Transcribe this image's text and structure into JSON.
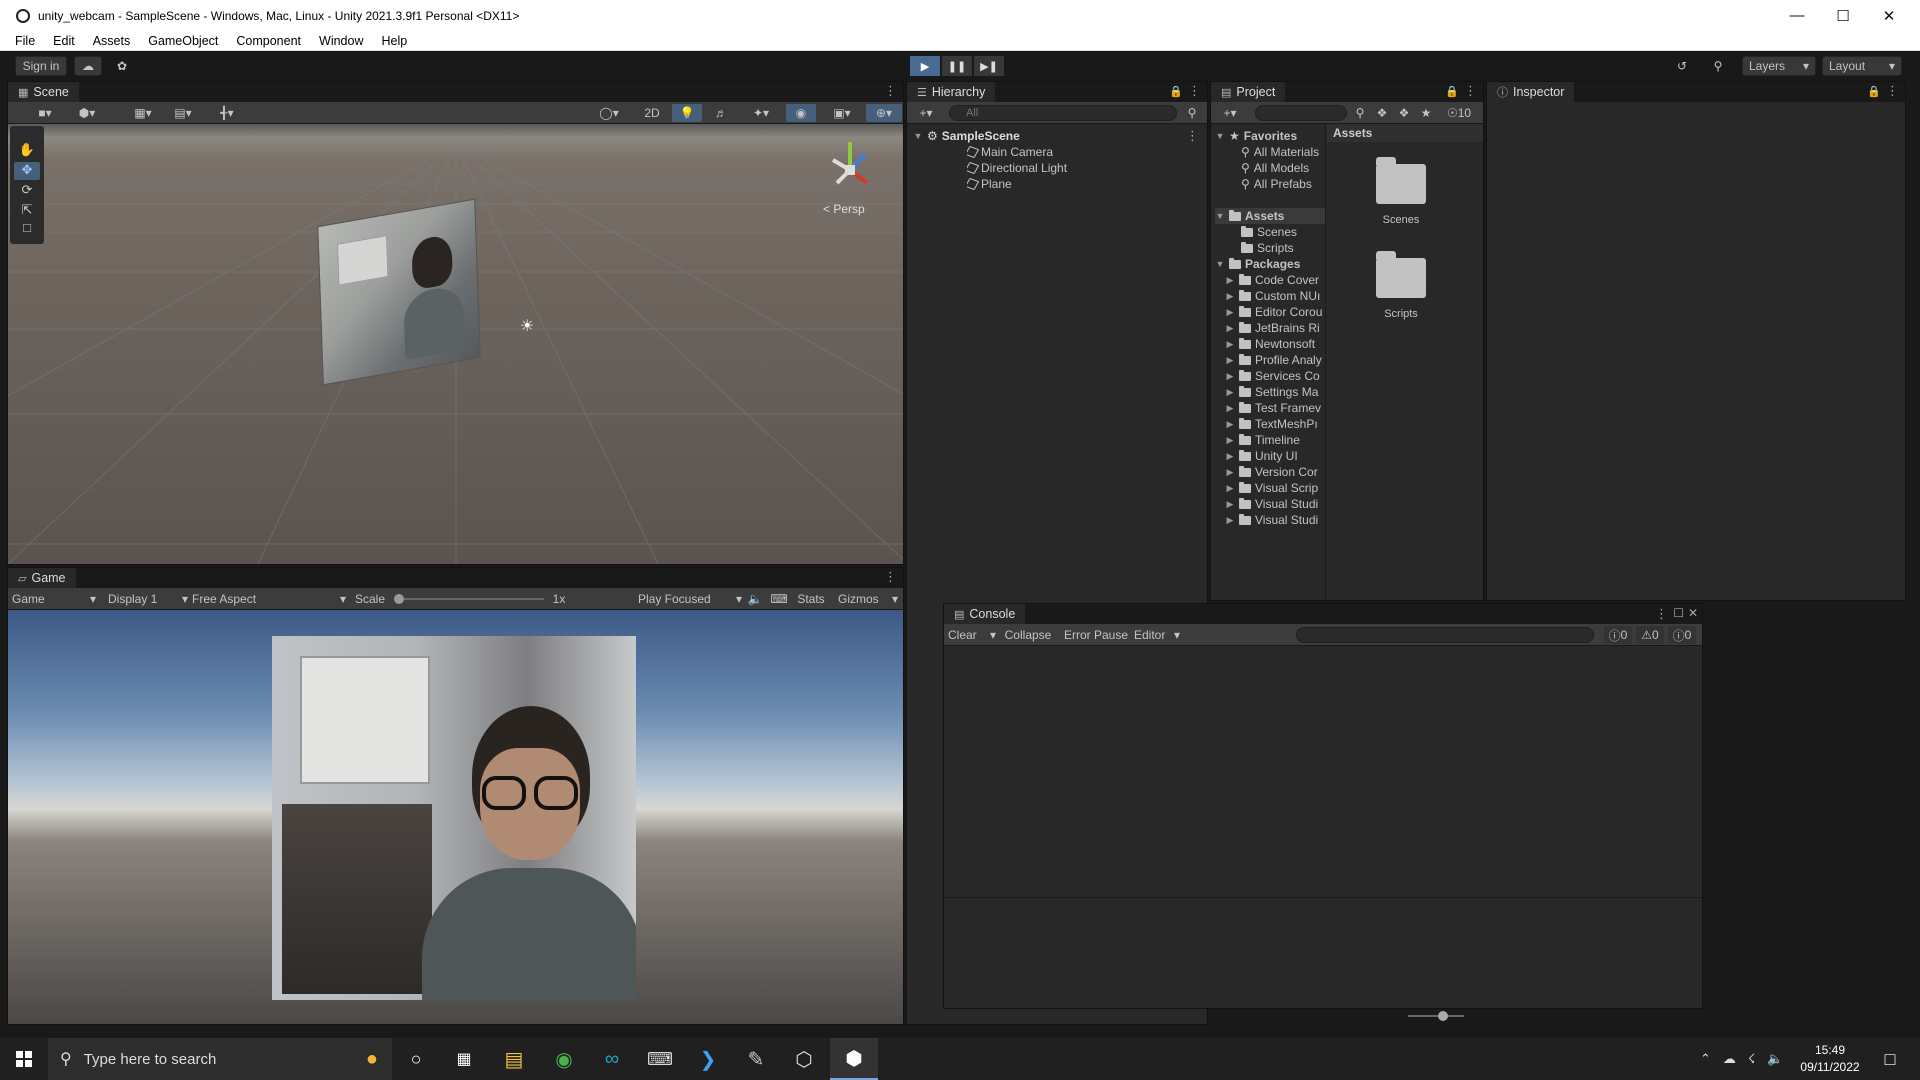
{
  "window": {
    "title": "unity_webcam - SampleScene - Windows, Mac, Linux - Unity 2021.3.9f1 Personal <DX11>"
  },
  "menu": [
    "File",
    "Edit",
    "Assets",
    "GameObject",
    "Component",
    "Window",
    "Help"
  ],
  "toolbar": {
    "sign_in": "Sign in",
    "layers": "Layers",
    "layout": "Layout"
  },
  "scene": {
    "tab": "Scene",
    "btn_2d": "2D",
    "persp": "< Persp"
  },
  "game": {
    "tab": "Game",
    "mode": "Game",
    "display": "Display 1",
    "aspect": "Free Aspect",
    "scale_label": "Scale",
    "scale_value": "1x",
    "play_focused": "Play Focused",
    "stats": "Stats",
    "gizmos": "Gizmos"
  },
  "hierarchy": {
    "tab": "Hierarchy",
    "search_placeholder": "All",
    "scene": "SampleScene",
    "objects": [
      "Main Camera",
      "Directional Light",
      "Plane"
    ]
  },
  "project": {
    "tab": "Project",
    "hidden_count": "10",
    "favorites_label": "Favorites",
    "favorites": [
      "All Materials",
      "All Models",
      "All Prefabs"
    ],
    "assets_label": "Assets",
    "assets": [
      "Scenes",
      "Scripts"
    ],
    "packages_label": "Packages",
    "packages": [
      "Code Cover",
      "Custom NUı",
      "Editor Corou",
      "JetBrains Ri",
      "Newtonsoft",
      "Profile Analy",
      "Services Co",
      "Settings Ma",
      "Test Framev",
      "TextMeshPı",
      "Timeline",
      "Unity UI",
      "Version Cor",
      "Visual Scrip",
      "Visual Studi",
      "Visual Studi"
    ],
    "breadcrumb": "Assets",
    "grid_items": [
      "Scenes",
      "Scripts"
    ]
  },
  "inspector": {
    "tab": "Inspector"
  },
  "console": {
    "tab": "Console",
    "clear": "Clear",
    "collapse": "Collapse",
    "error_pause": "Error Pause",
    "editor": "Editor",
    "log_count": "0",
    "warn_count": "0",
    "error_count": "0"
  },
  "taskbar": {
    "search_placeholder": "Type here to search",
    "time": "15:49",
    "date": "09/11/2022"
  },
  "colors": {
    "accent": "#4a6b91",
    "panel": "#282828",
    "background": "#191919"
  }
}
